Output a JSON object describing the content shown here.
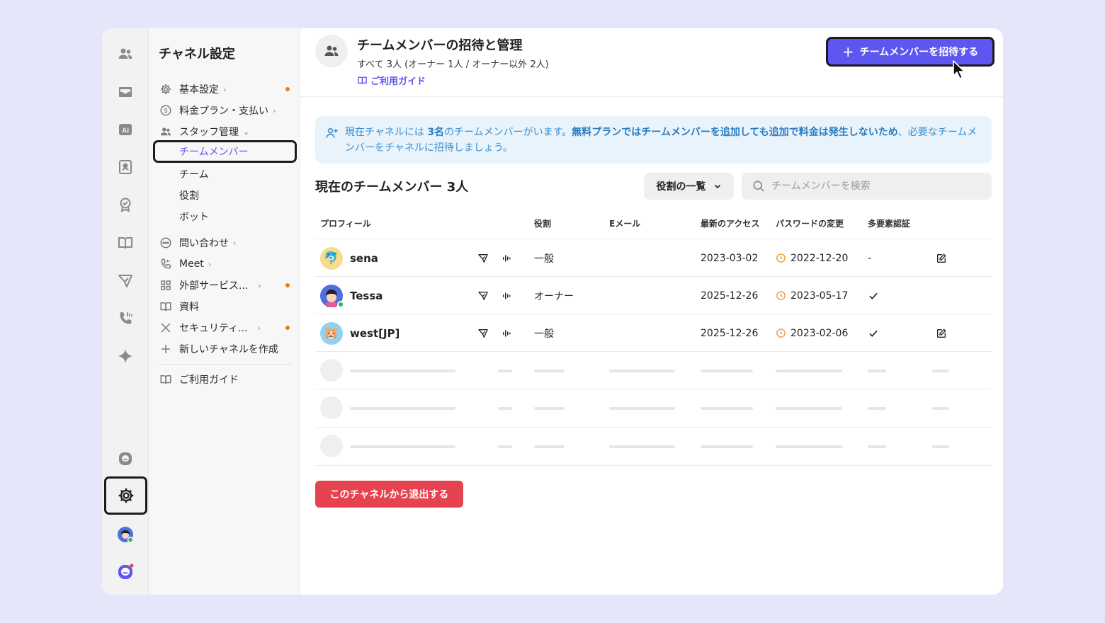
{
  "sidebar": {
    "title": "チャネル設定",
    "items": [
      {
        "label": "基本設定"
      },
      {
        "label": "料金プラン・支払い"
      },
      {
        "label": "スタッフ管理"
      },
      {
        "label": "チームメンバー"
      },
      {
        "label": "チーム"
      },
      {
        "label": "役割"
      },
      {
        "label": "ボット"
      },
      {
        "label": "問い合わせ"
      },
      {
        "label": "Meet"
      },
      {
        "label": "外部サービス..."
      },
      {
        "label": "資料"
      },
      {
        "label": "セキュリティ..."
      },
      {
        "label": "新しいチャネルを作成"
      },
      {
        "label": "ご利用ガイド"
      }
    ]
  },
  "header": {
    "title": "チームメンバーの招待と管理",
    "subtitle": "すべて 3人 (オーナー 1人 / オーナー以外 2人)",
    "guide_label": "ご利用ガイド",
    "invite_label": "チームメンバーを招待する"
  },
  "notice": {
    "part1": "現在チャネルには ",
    "count": "3名",
    "part2": "のチームメンバーがいます。",
    "bold": "無料プランではチームメンバーを追加しても追加で料金は発生しないため",
    "part3": "、必要なチームメンバーをチャネルに招待しましょう。"
  },
  "members_section": {
    "title": "現在のチームメンバー 3人",
    "role_filter": "役割の一覧",
    "search_placeholder": "チームメンバーを検索"
  },
  "table": {
    "headers": [
      "プロフィール",
      "役割",
      "Eメール",
      "最新のアクセス",
      "パスワードの変更",
      "多要素認証"
    ],
    "rows": [
      {
        "name": "sena",
        "avatar": "🐬",
        "role": "一般",
        "email": "",
        "last_access": "2023-03-02",
        "password_changed": "2022-12-20",
        "mfa": "-"
      },
      {
        "name": "Tessa",
        "avatar": "person",
        "role": "オーナー",
        "email": "",
        "last_access": "2025-12-26",
        "password_changed": "2023-05-17",
        "mfa": "check"
      },
      {
        "name": "west[JP]",
        "avatar": "🐹",
        "role": "一般",
        "email": "",
        "last_access": "2025-12-26",
        "password_changed": "2023-02-06",
        "mfa": "check"
      }
    ]
  },
  "leave_button": "このチャネルから退出する",
  "colors": {
    "accent": "#5e56f0",
    "danger": "#e5434f",
    "notice_bg": "#e9f3fb",
    "notice_text": "#3b8fd0",
    "warning_dot": "#f17c0c",
    "success": "#2db55d"
  }
}
